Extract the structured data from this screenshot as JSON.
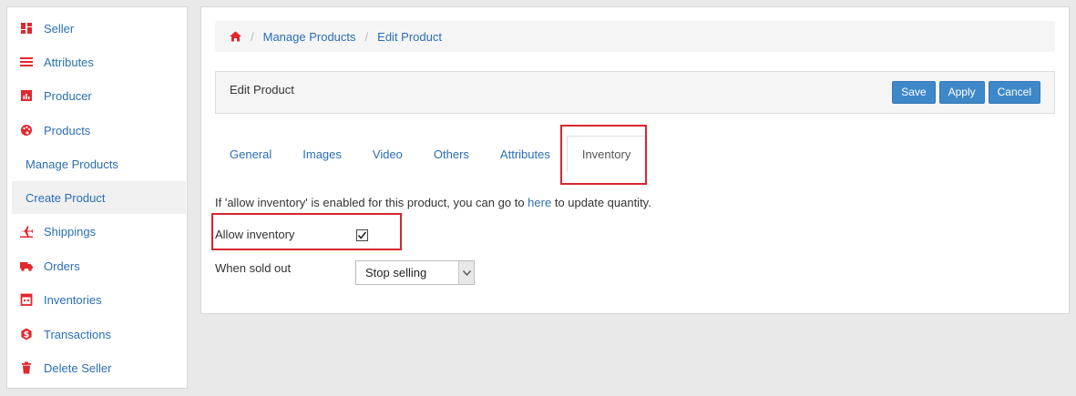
{
  "sidebar": {
    "items": [
      {
        "label": "Seller",
        "icon": "dashboard-icon"
      },
      {
        "label": "Attributes",
        "icon": "list-icon"
      },
      {
        "label": "Producer",
        "icon": "bar-chart-icon"
      },
      {
        "label": "Products",
        "icon": "palette-icon"
      },
      {
        "label": "Manage Products",
        "icon": ""
      },
      {
        "label": "Create Product",
        "icon": ""
      },
      {
        "label": "Shippings",
        "icon": "plane-icon"
      },
      {
        "label": "Orders",
        "icon": "truck-icon"
      },
      {
        "label": "Inventories",
        "icon": "calendar-icon"
      },
      {
        "label": "Transactions",
        "icon": "dollar-icon"
      },
      {
        "label": "Delete Seller",
        "icon": "trash-icon"
      }
    ]
  },
  "breadcrumb": {
    "items": [
      "Manage Products",
      "Edit Product"
    ]
  },
  "panel": {
    "title": "Edit Product",
    "save_label": "Save",
    "apply_label": "Apply",
    "cancel_label": "Cancel"
  },
  "tabs": [
    "General",
    "Images",
    "Video",
    "Others",
    "Attributes",
    "Inventory"
  ],
  "inventory": {
    "info_prefix": "If 'allow inventory' is enabled for this product, you can go to",
    "info_link": "here",
    "info_suffix": "to update quantity.",
    "allow_label": "Allow inventory",
    "allow_checked": true,
    "sold_out_label": "When sold out",
    "sold_out_value": "Stop selling"
  },
  "colors": {
    "accent": "#3f88c8",
    "link": "#2a6eb5",
    "highlight": "#d7262e",
    "icon": "#e0282e"
  }
}
